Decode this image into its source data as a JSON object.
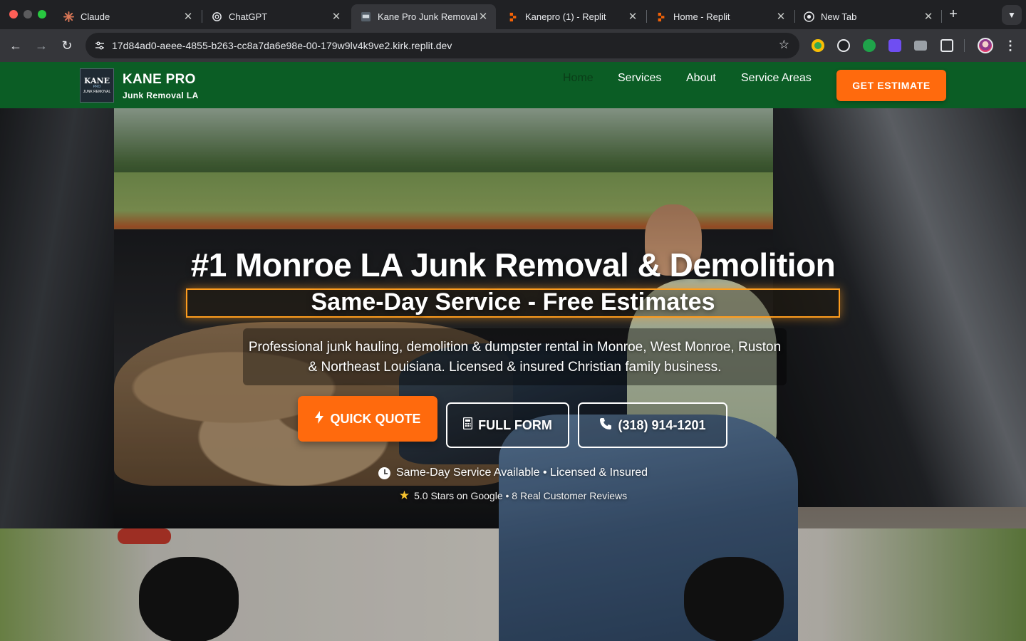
{
  "browser": {
    "tabs": [
      {
        "title": "Claude",
        "active": false
      },
      {
        "title": "ChatGPT",
        "active": false
      },
      {
        "title": "Kane Pro Junk Removal",
        "active": true
      },
      {
        "title": "Kanepro (1) - Replit",
        "active": false
      },
      {
        "title": "Home - Replit",
        "active": false
      },
      {
        "title": "New Tab",
        "active": false
      }
    ],
    "url": "17d84ad0-aeee-4855-b263-cc8a7da6e98e-00-179w9lv4k9ve2.kirk.replit.dev"
  },
  "site": {
    "logo": {
      "line1": "KANE",
      "line2": "PRO",
      "line3": "JUNK REMOVAL"
    },
    "brand_name": "KANE PRO",
    "brand_sub": "Junk Removal LA",
    "nav": [
      "Home",
      "Services",
      "About",
      "Service Areas"
    ],
    "nav_active": "Home",
    "cta": "GET ESTIMATE",
    "colors": {
      "nav_bg": "#0b5d25",
      "accent": "#ff6a0d",
      "band": "#ff9d1e"
    }
  },
  "hero": {
    "title": "#1 Monroe LA Junk Removal & Demolition",
    "subtitle": "Same-Day Service - Free Estimates",
    "description": "Professional junk hauling, demolition & dumpster rental in Monroe, West Monroe, Ruston & Northeast Louisiana. Licensed & insured Christian family business.",
    "buttons": {
      "quick_quote": "QUICK QUOTE",
      "full_form": "FULL FORM",
      "phone": "(318) 914-1201"
    },
    "trust_line_1": "Same-Day Service Available • Licensed & Insured",
    "trust_line_2": "5.0 Stars on Google • 8 Real Customer Reviews"
  }
}
